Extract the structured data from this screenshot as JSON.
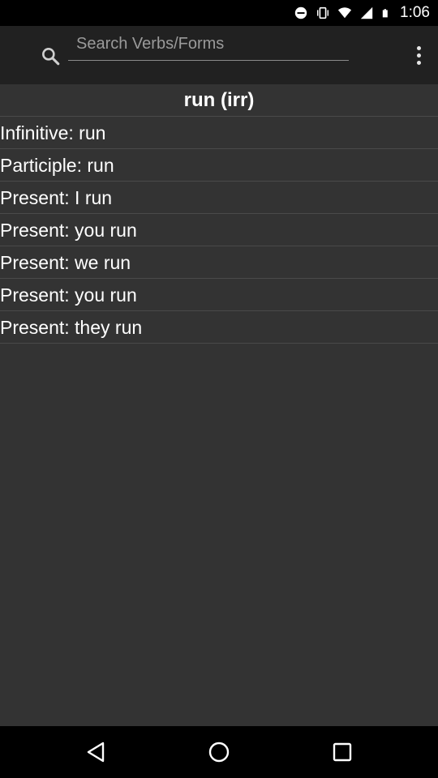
{
  "status_bar": {
    "time": "1:06",
    "icons": [
      "minus-circle-icon",
      "vibrate-icon",
      "wifi-icon",
      "signal-icon",
      "battery-icon"
    ]
  },
  "app_bar": {
    "search_icon": "search-icon",
    "search_placeholder": "Search Verbs/Forms",
    "search_value": "",
    "menu_icon": "overflow-menu-icon"
  },
  "verb": {
    "title": "run (irr)",
    "forms": [
      "Infinitive: run",
      "Participle: run",
      "Present: I run",
      "Present: you run",
      "Present: we run",
      "Present: you run",
      "Present: they run"
    ]
  },
  "nav_bar": {
    "icons": [
      "back-icon",
      "home-icon",
      "recents-icon"
    ]
  },
  "colors": {
    "app_bar_bg": "#212121",
    "content_bg": "#333333",
    "system_bar_bg": "#000000"
  }
}
